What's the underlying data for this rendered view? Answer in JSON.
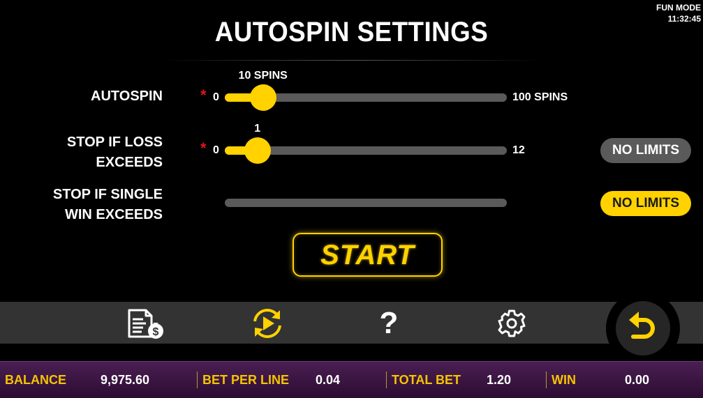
{
  "header": {
    "mode": "FUN MODE",
    "clock": "11:32:45"
  },
  "title": "AUTOSPIN SETTINGS",
  "settings": {
    "autospin": {
      "label": "AUTOSPIN",
      "min_label": "0",
      "max_label": "100 SPINS",
      "value_label": "10 SPINS",
      "value": 10,
      "max": 100,
      "required": true
    },
    "stop_loss": {
      "label_line1": "STOP IF LOSS",
      "label_line2": "EXCEEDS",
      "min_label": "0",
      "max_label": "12",
      "value_label": "1",
      "value": 1,
      "max": 12,
      "required": true,
      "button_label": "NO LIMITS"
    },
    "stop_single_win": {
      "label_line1": "STOP IF SINGLE",
      "label_line2": "WIN EXCEEDS",
      "button_label": "NO LIMITS"
    },
    "required_marker": "*"
  },
  "start_button": "START",
  "toolbar": {
    "icons": [
      "paytable-icon",
      "autoplay-icon",
      "help-icon",
      "settings-gear-icon",
      "back-arrow-icon"
    ],
    "help_glyph": "?"
  },
  "status": {
    "balance_label": "BALANCE",
    "balance_value": "9,975.60",
    "bet_per_line_label": "BET PER LINE",
    "bet_per_line_value": "0.04",
    "total_bet_label": "TOTAL BET",
    "total_bet_value": "1.20",
    "win_label": "WIN",
    "win_value": "0.00"
  },
  "colors": {
    "accent": "#ffd200",
    "track": "#5a5a5a",
    "required_star": "#e0141d",
    "status_bar": "#3b1543"
  }
}
